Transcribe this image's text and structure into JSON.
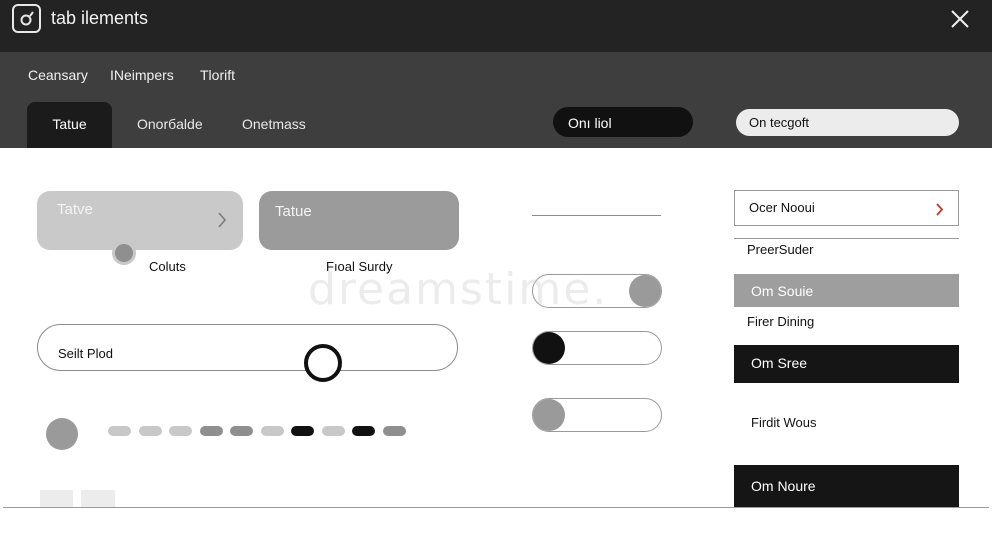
{
  "window": {
    "title": "tab ilements",
    "icon": "camera-icon",
    "close_icon": "close-icon"
  },
  "menu": {
    "items": [
      {
        "label": "Ceansary"
      },
      {
        "label": "INeimpers"
      },
      {
        "label": "Tlorift"
      }
    ]
  },
  "tabs": [
    {
      "label": "Tatue",
      "active": true
    },
    {
      "label": "Onorбalde",
      "active": false
    },
    {
      "label": "Onetmass",
      "active": false
    }
  ],
  "header_controls": {
    "dark_pill": "Onı liol",
    "light_pill": "On tecgoft"
  },
  "cards": [
    {
      "label": "Tatve",
      "caption": "Coluts",
      "chevron_icon": "chevron-right-icon"
    },
    {
      "label": "Tatue",
      "caption": "Fıoal Surdy"
    }
  ],
  "slider": {
    "label": "Seilt Plod",
    "value_percent": 67
  },
  "pagination": {
    "colors": [
      "#c8c8c8",
      "#c8c8c8",
      "#c8c8c8",
      "#8f8f8f",
      "#8f8f8f",
      "#c8c8c8",
      "#111111",
      "#c8c8c8",
      "#111111",
      "#8f8f8f"
    ]
  },
  "toggles": [
    {
      "state": "on",
      "knob_color": "#9a9a9a"
    },
    {
      "state": "off",
      "knob_color": "#111111"
    },
    {
      "state": "off",
      "knob_color": "#9a9a9a"
    }
  ],
  "list": {
    "top_item": "Ocer Nooui",
    "chevron_color": "#c0392b",
    "rows": [
      {
        "label": "PreerSuder",
        "style": "plain"
      },
      {
        "label": "Om Souie",
        "style": "gray"
      },
      {
        "label": "Firer Dining",
        "style": "plain"
      },
      {
        "label": "Om Sree",
        "style": "black"
      },
      {
        "label": "Firdit Wous",
        "style": "plain"
      },
      {
        "label": "Om Noure",
        "style": "black"
      }
    ]
  },
  "watermark": "dreamstime."
}
